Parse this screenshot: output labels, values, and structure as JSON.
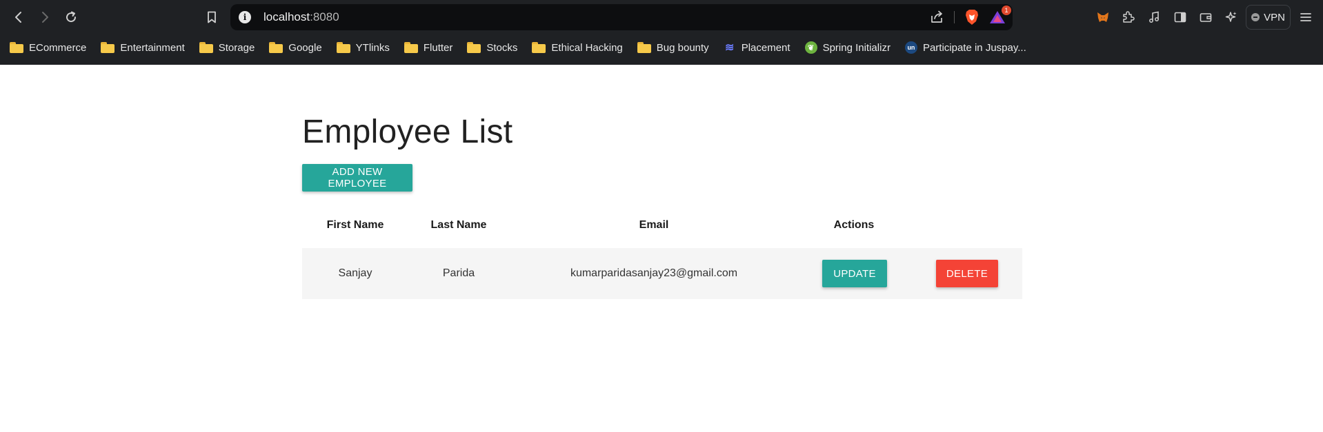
{
  "browser": {
    "url_host": "localhost",
    "url_port": ":8080",
    "rewards_badge": "1",
    "vpn_label": "VPN",
    "bookmarks": [
      {
        "label": "ECommerce",
        "icon": "folder-icon"
      },
      {
        "label": "Entertainment",
        "icon": "folder-icon"
      },
      {
        "label": "Storage",
        "icon": "folder-icon"
      },
      {
        "label": "Google",
        "icon": "folder-icon"
      },
      {
        "label": "YTlinks",
        "icon": "folder-icon"
      },
      {
        "label": "Flutter",
        "icon": "folder-icon"
      },
      {
        "label": "Stocks",
        "icon": "folder-icon"
      },
      {
        "label": "Ethical Hacking",
        "icon": "folder-icon"
      },
      {
        "label": "Bug bounty",
        "icon": "folder-icon"
      },
      {
        "label": "Placement",
        "icon": "placement-icon"
      },
      {
        "label": "Spring Initializr",
        "icon": "spring-icon"
      },
      {
        "label": "Participate in Juspay...",
        "icon": "unstop-icon"
      }
    ]
  },
  "page": {
    "title": "Employee List",
    "add_button": "ADD NEW EMPLOYEE",
    "table": {
      "headers": {
        "first_name": "First Name",
        "last_name": "Last Name",
        "email": "Email",
        "actions": "Actions"
      },
      "rows": [
        {
          "first_name": "Sanjay",
          "last_name": "Parida",
          "email": "kumarparidasanjay23@gmail.com",
          "update_label": "UPDATE",
          "delete_label": "DELETE"
        }
      ]
    }
  },
  "colors": {
    "primary": "#26a69a",
    "danger": "#f44336",
    "chrome_bg": "#1f2124"
  }
}
